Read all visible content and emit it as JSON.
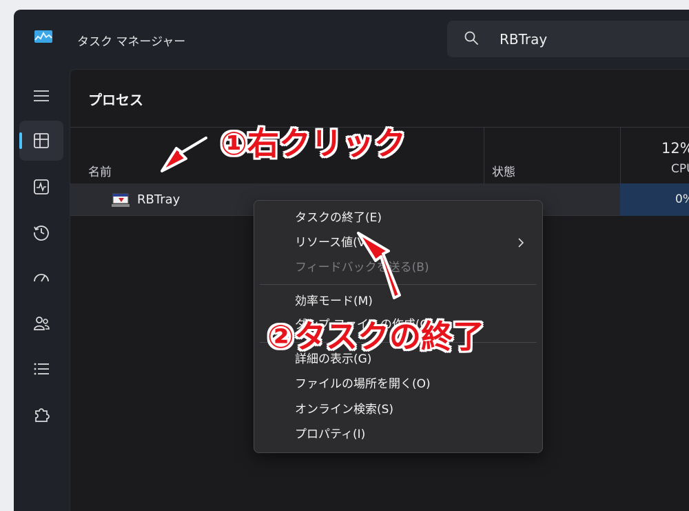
{
  "window": {
    "title": "タスク マネージャー",
    "search": {
      "value": "RBTray",
      "icon": "search-icon"
    }
  },
  "nav": [
    {
      "name": "hamburger-menu",
      "icon": "menu-icon",
      "active": false
    },
    {
      "name": "processes",
      "icon": "processes-icon",
      "active": true
    },
    {
      "name": "performance",
      "icon": "performance-icon",
      "active": false
    },
    {
      "name": "app-history",
      "icon": "history-icon",
      "active": false
    },
    {
      "name": "startup-apps",
      "icon": "speedometer-icon",
      "active": false
    },
    {
      "name": "users",
      "icon": "users-icon",
      "active": false
    },
    {
      "name": "details",
      "icon": "list-icon",
      "active": false
    },
    {
      "name": "services",
      "icon": "puzzle-icon",
      "active": false
    }
  ],
  "page": {
    "title": "プロセス",
    "columns": {
      "name": "名前",
      "status": "状態",
      "cpu_percent": "12%",
      "cpu_label": "CPU"
    },
    "rows": [
      {
        "name": "RBTray",
        "cpu": "0%"
      }
    ]
  },
  "context_menu": {
    "items": [
      {
        "label": "タスクの終了(E)"
      },
      {
        "label": "リソース値(V)",
        "has_submenu": true
      },
      {
        "label": "フィードバックを送る(B)",
        "disabled": true
      },
      {
        "label": "効率モード(M)"
      },
      {
        "label": "ダンプ ファイルの作成(C)"
      },
      {
        "label": "詳細の表示(G)"
      },
      {
        "label": "ファイルの場所を開く(O)"
      },
      {
        "label": "オンライン検索(S)"
      },
      {
        "label": "プロパティ(I)"
      }
    ]
  },
  "annotations": {
    "step1": "①右クリック",
    "step2": "②タスクの終了",
    "color": "#e8141c"
  },
  "colors": {
    "accent": "#4cc2ff",
    "cpu_highlight": "#1f3859"
  }
}
